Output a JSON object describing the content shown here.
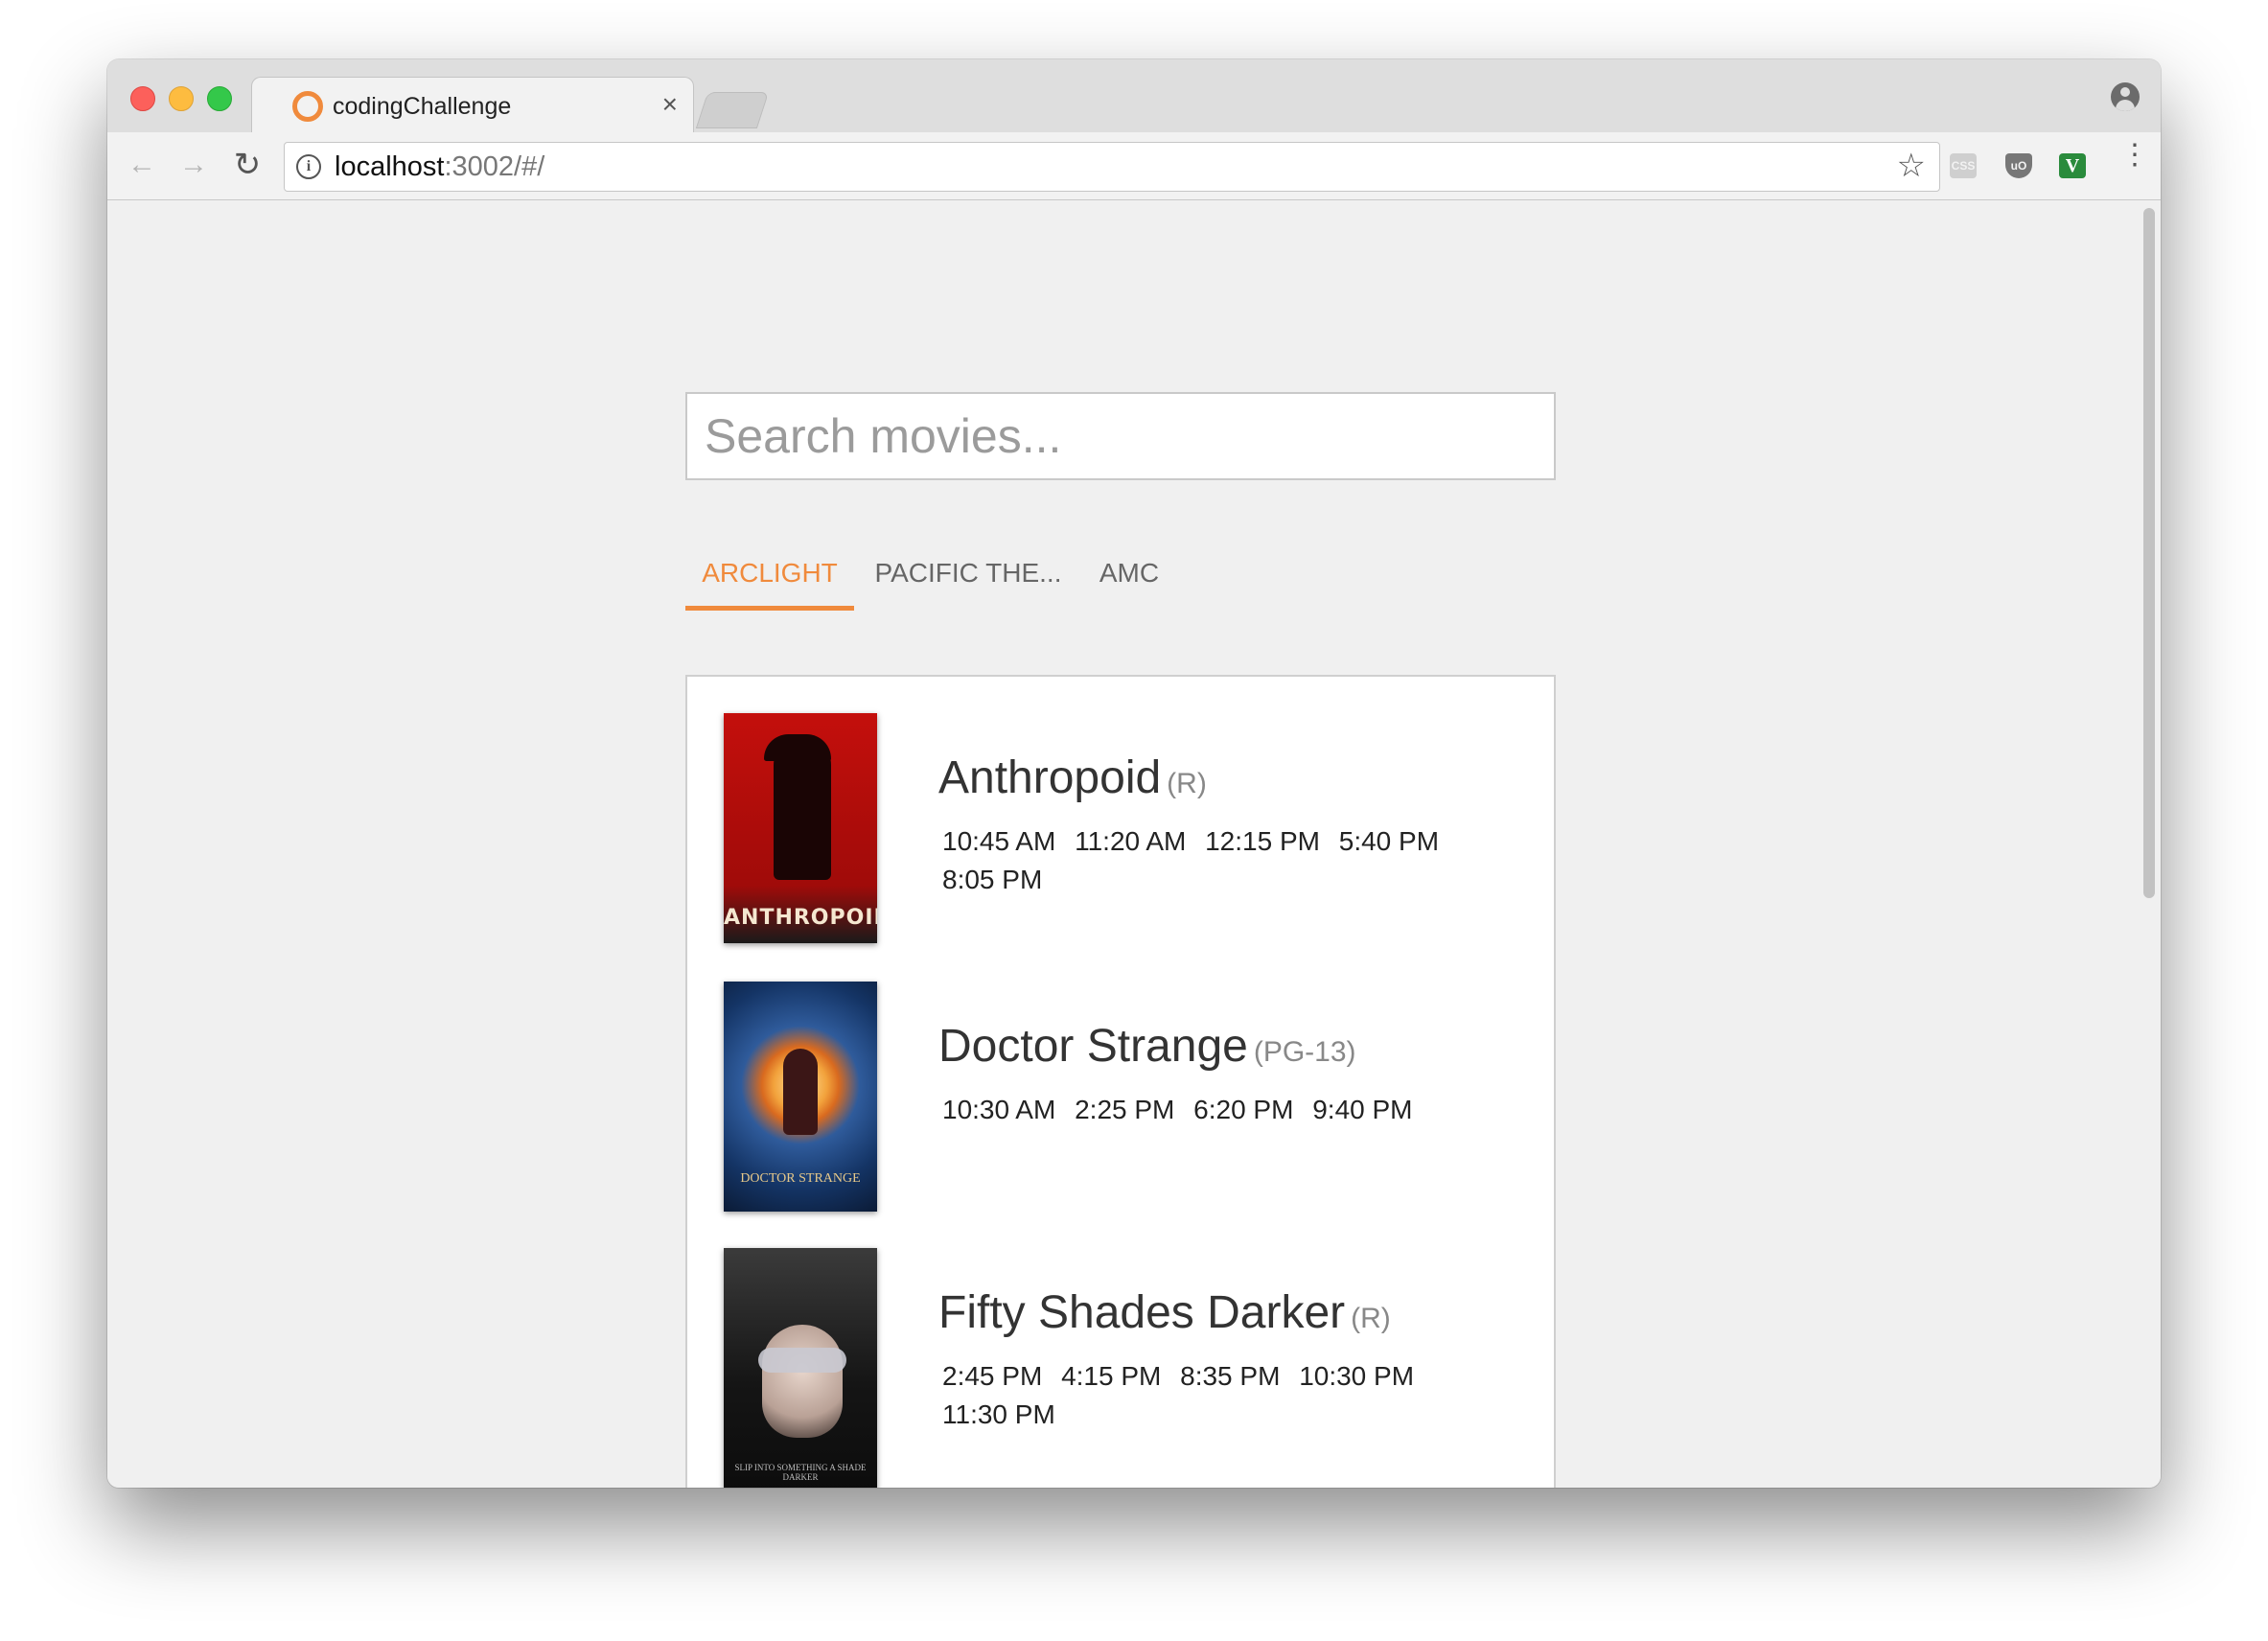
{
  "browser": {
    "tab_title": "codingChallenge",
    "tab_close": "×",
    "url_host": "localhost",
    "url_rest": ":3002/#/",
    "info_icon": "i",
    "star_icon": "☆",
    "reload_icon": "↻",
    "back_icon": "←",
    "forward_icon": "→",
    "menu_icon": "⋮",
    "extensions": {
      "css": "CSS",
      "ublock": "uO",
      "v": "V"
    }
  },
  "search": {
    "placeholder": "Search movies...",
    "value": ""
  },
  "theater_tabs": [
    {
      "label": "ARCLIGHT",
      "active": true
    },
    {
      "label": "PACIFIC THE...",
      "active": false
    },
    {
      "label": "AMC",
      "active": false
    }
  ],
  "movies": [
    {
      "title": "Anthropoid",
      "rating": "(R)",
      "poster_text": "ANTHROPOID",
      "showtimes": [
        "10:45 AM",
        "11:20 AM",
        "12:15 PM",
        "5:40 PM",
        "8:05 PM"
      ]
    },
    {
      "title": "Doctor Strange",
      "rating": "(PG-13)",
      "poster_text": "DOCTOR STRANGE",
      "showtimes": [
        "10:30 AM",
        "2:25 PM",
        "6:20 PM",
        "9:40 PM"
      ]
    },
    {
      "title": "Fifty Shades Darker",
      "rating": "(R)",
      "poster_text": "SLIP INTO SOMETHING A SHADE DARKER",
      "showtimes": [
        "2:45 PM",
        "4:15 PM",
        "8:35 PM",
        "10:30 PM",
        "11:30 PM"
      ]
    }
  ],
  "colors": {
    "accent": "#f08a3c",
    "page_bg": "#f0f0f0"
  }
}
